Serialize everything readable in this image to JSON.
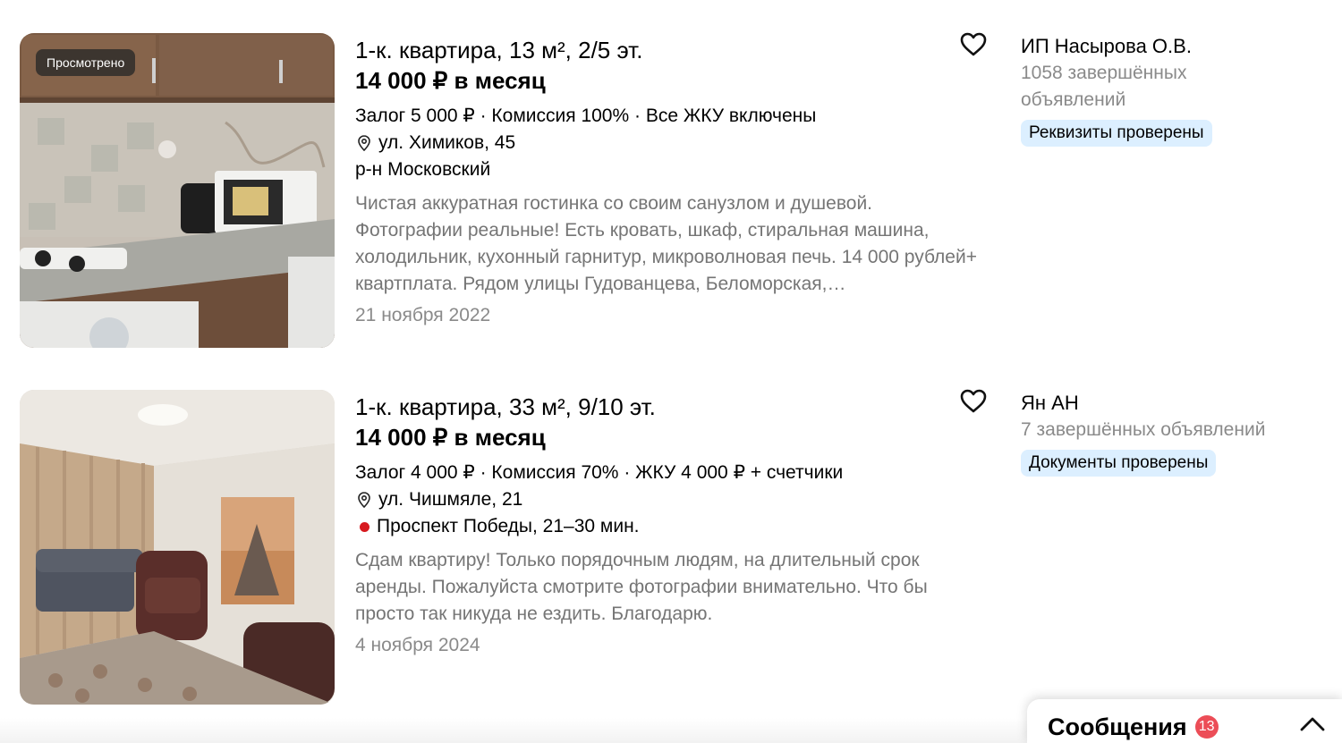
{
  "colors": {
    "badge_bg": "#dcefff",
    "metro_red": "#d7191f",
    "messages_badge": "#ec4d57"
  },
  "listings": [
    {
      "seen_label": "Просмотрено",
      "title": "1-к. квартира, 13 м², 2/5 эт.",
      "price": "14 000 ₽ в месяц",
      "terms": "Залог 5 000 ₽ · Комиссия 100% · Все ЖКУ включены",
      "address": "ул. Химиков, 45",
      "district": "р-н Московский",
      "description": "Чистая аккуратная гостинка со своим санузлом и душевой. Фотографии реальные! Есть кровать, шкаф, стиральная машина, холодильник, кухонный гарнитур, микроволновая печь. 14 000 рублей+ квартплата. Рядом улицы Гудованцева, Беломорская,…",
      "date": "21 ноября 2022",
      "favorite_icon": "heart-outline-icon",
      "seller": {
        "name": "ИП Насырова О.В.",
        "count": "1058 завершённых объявлений",
        "badge": "Реквизиты проверены"
      }
    },
    {
      "title": "1-к. квартира, 33 м², 9/10 эт.",
      "price": "14 000 ₽ в месяц",
      "terms": "Залог 4 000 ₽ · Комиссия 70% · ЖКУ 4 000 ₽ + счетчики",
      "address": "ул. Чишмяле, 21",
      "metro": "Проспект Победы, 21–30 мин.",
      "description": "Сдам квартиру! Только порядочным людям, на длительный срок аренды. Пожалуйста смотрите фотографии внимательно. Что бы просто так никуда не ездить. Благодарю.",
      "date": "4 ноября 2024",
      "favorite_icon": "heart-outline-icon",
      "seller": {
        "name": "Ян АН",
        "count": "7 завершённых объявлений",
        "badge": "Документы проверены"
      }
    }
  ],
  "messages": {
    "label": "Сообщения",
    "count": "13",
    "icon": "chevron-up-icon"
  }
}
